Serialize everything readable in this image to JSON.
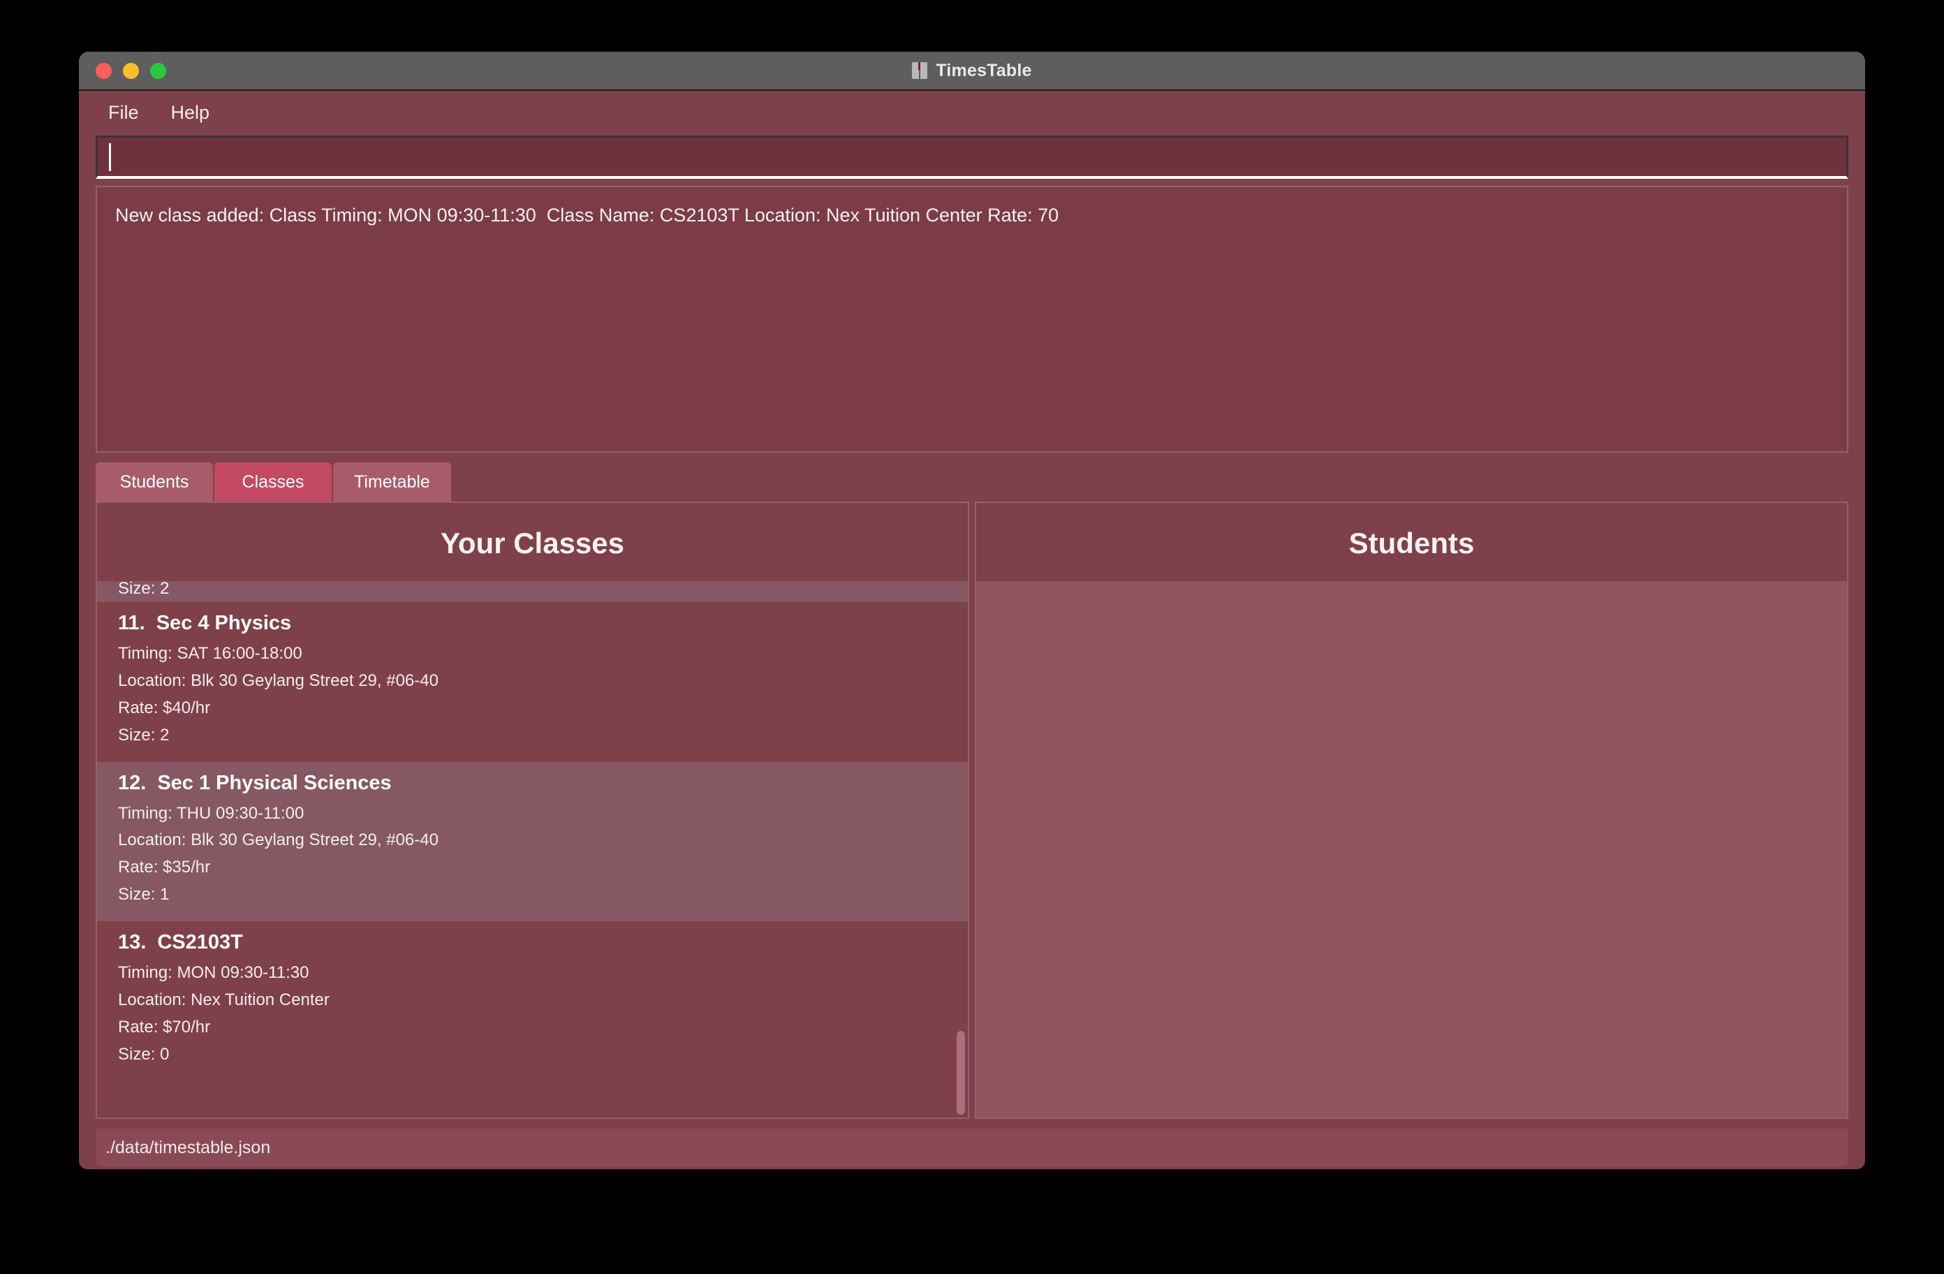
{
  "window": {
    "title": "TimesTable",
    "icon": "book-icon",
    "traffic_lights": [
      {
        "name": "close",
        "color": "#ff5f56"
      },
      {
        "name": "minimize",
        "color": "#ffbd2e"
      },
      {
        "name": "maximize",
        "color": "#27c93f"
      }
    ]
  },
  "menu": {
    "items": [
      {
        "label": "File"
      },
      {
        "label": "Help"
      }
    ]
  },
  "command": {
    "value": "",
    "placeholder": ""
  },
  "result": {
    "text": "New class added: Class Timing: MON 09:30-11:30  Class Name: CS2103T Location: Nex Tuition Center Rate: 70"
  },
  "tabs": [
    {
      "label": "Students",
      "selected": false
    },
    {
      "label": "Classes",
      "selected": true
    },
    {
      "label": "Timetable",
      "selected": false
    }
  ],
  "panels": {
    "classes": {
      "header": "Your Classes",
      "clipped_top_line": "Size: 2",
      "items": [
        {
          "index": "11.",
          "name": "Sec 4 Physics",
          "timing": "Timing: SAT 16:00-18:00",
          "location": "Location: Blk 30 Geylang Street 29, #06-40",
          "rate": "Rate: $40/hr",
          "size": "Size: 2"
        },
        {
          "index": "12.",
          "name": "Sec 1 Physical Sciences",
          "timing": "Timing: THU 09:30-11:00",
          "location": "Location: Blk 30 Geylang Street 29, #06-40",
          "rate": "Rate: $35/hr",
          "size": "Size: 1"
        },
        {
          "index": "13.",
          "name": "CS2103T",
          "timing": "Timing: MON 09:30-11:30",
          "location": "Location: Nex Tuition Center",
          "rate": "Rate: $70/hr",
          "size": "Size: 0"
        }
      ]
    },
    "students": {
      "header": "Students",
      "items": []
    }
  },
  "status": {
    "file_path": "./data/timestable.json"
  },
  "colors": {
    "window_background": "#7e4049",
    "title_bar": "#5e5e5e",
    "tab_selected": "#c34a62",
    "tab_normal": "#a85c69",
    "row_alt": "#855863",
    "students_body": "#90555f",
    "result_box": "#7b3c46",
    "command_box": "#6f313c",
    "text": "#f4eeee"
  }
}
